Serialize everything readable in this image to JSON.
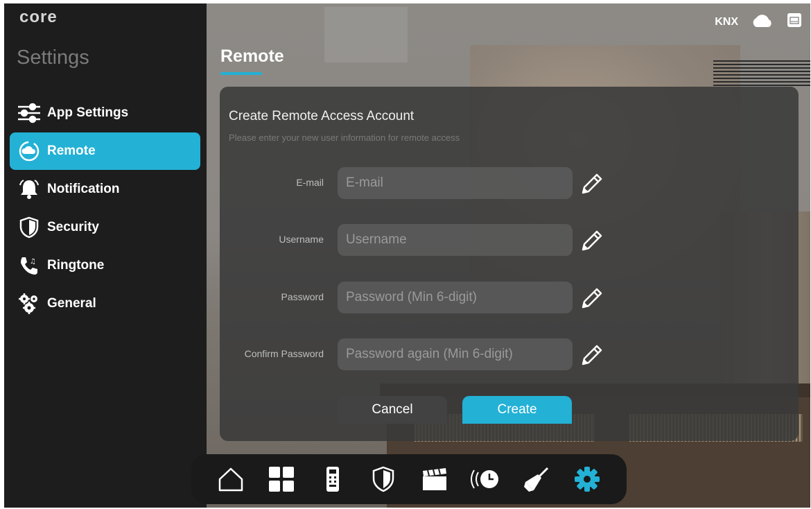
{
  "app": {
    "logo": "core",
    "sidebar_title": "Settings"
  },
  "header": {
    "protocol": "KNX",
    "cloud_icon": "cloud-icon",
    "network_icon": "router-icon"
  },
  "sidebar": {
    "items": [
      {
        "label": "App Settings",
        "icon": "sliders-icon",
        "active": false
      },
      {
        "label": "Remote",
        "icon": "cloud-sync-icon",
        "active": true
      },
      {
        "label": "Notification",
        "icon": "bell-icon",
        "active": false
      },
      {
        "label": "Security",
        "icon": "shield-icon",
        "active": false
      },
      {
        "label": "Ringtone",
        "icon": "phone-music-icon",
        "active": false
      },
      {
        "label": "General",
        "icon": "gears-icon",
        "active": false
      }
    ]
  },
  "page": {
    "title": "Remote"
  },
  "form": {
    "title": "Create Remote Access Account",
    "subtitle": "Please enter your new user information for remote access",
    "fields": [
      {
        "label": "E-mail",
        "placeholder": "E-mail"
      },
      {
        "label": "Username",
        "placeholder": "Username"
      },
      {
        "label": "Password",
        "placeholder": "Password (Min 6-digit)"
      },
      {
        "label": "Confirm Password",
        "placeholder": "Password again (Min 6-digit)"
      }
    ],
    "cancel_label": "Cancel",
    "create_label": "Create"
  },
  "dock": {
    "items": [
      {
        "icon": "home-icon",
        "active": false
      },
      {
        "icon": "grid-icon",
        "active": false
      },
      {
        "icon": "intercom-icon",
        "active": false
      },
      {
        "icon": "shield-icon",
        "active": false
      },
      {
        "icon": "clapperboard-icon",
        "active": false
      },
      {
        "icon": "schedule-icon",
        "active": false
      },
      {
        "icon": "broom-icon",
        "active": false
      },
      {
        "icon": "gear-icon",
        "active": true
      }
    ]
  },
  "colors": {
    "accent": "#23b1d5",
    "sidebar_bg": "#1d1d1d",
    "panel_bg": "#3a3a3a"
  }
}
